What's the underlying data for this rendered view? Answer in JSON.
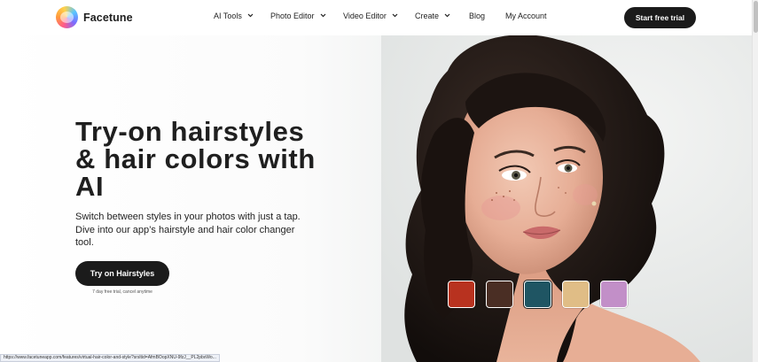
{
  "header": {
    "brand": "Facetune",
    "nav": [
      {
        "label": "AI Tools",
        "has_dropdown": true
      },
      {
        "label": "Photo Editor",
        "has_dropdown": true
      },
      {
        "label": "Video Editor",
        "has_dropdown": true
      },
      {
        "label": "Create",
        "has_dropdown": true
      },
      {
        "label": "Blog",
        "has_dropdown": false
      },
      {
        "label": "My Account",
        "has_dropdown": false
      }
    ],
    "cta_label": "Start free trial"
  },
  "hero": {
    "title_line1": "Try-on hairstyles",
    "title_line2": "& hair colors with",
    "title_line3": "AI",
    "subtitle": "Switch between styles in your photos with just a tap. Dive into our app’s hairstyle and hair color changer tool.",
    "button_label": "Try on Hairstyles",
    "trial_note": "7 day free trial, cancel anytime",
    "swatches": [
      {
        "name": "red",
        "color": "#b8321f"
      },
      {
        "name": "brown",
        "color": "#4a2e24"
      },
      {
        "name": "teal",
        "color": "#1f5563",
        "selected": true
      },
      {
        "name": "blonde",
        "color": "#e0bd86"
      },
      {
        "name": "lavender",
        "color": "#c28fc8"
      }
    ]
  },
  "status_url": "https://www.facetuneapp.com/features/virtual-hair-color-and-style?srsltid=AfmBOopXNU-9fzJ__PL2pbxWo..."
}
